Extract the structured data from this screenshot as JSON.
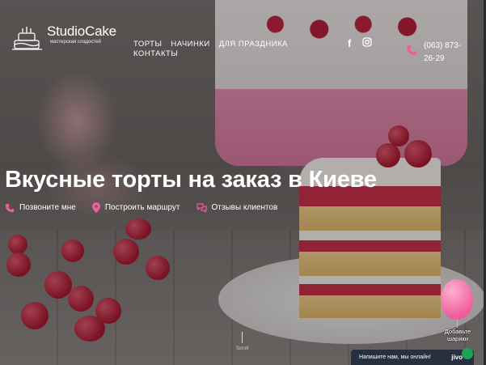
{
  "brand": {
    "name": "StudioCake",
    "tagline": "мастерская сладостей"
  },
  "nav": {
    "items": [
      "ТОРТЫ",
      "НАЧИНКИ",
      "ДЛЯ ПРАЗДНИКА",
      "КОНТАКТЫ"
    ]
  },
  "social": {
    "icons": [
      "facebook-icon",
      "instagram-icon"
    ],
    "facebook_glyph": "f",
    "instagram_glyph": "◎"
  },
  "contact": {
    "phone": "(063) 873-26-29"
  },
  "hero": {
    "headline": "Вкусные торты на заказ в Киеве",
    "actions": [
      {
        "label": "Позвоните мне",
        "icon": "phone-icon"
      },
      {
        "label": "Построить маршрут",
        "icon": "map-pin-icon"
      },
      {
        "label": "Отзывы клиентов",
        "icon": "chat-bubbles-icon"
      }
    ],
    "scroll_label": "Scroll"
  },
  "widgets": {
    "balloon_label": "Добавьте шарики",
    "chat_text": "Напишите нам, мы онлайн!",
    "chat_brand": "jivo"
  },
  "colors": {
    "accent": "#ef5d9d",
    "chat_bg": "#26303f",
    "chat_online": "#1ea35b"
  }
}
